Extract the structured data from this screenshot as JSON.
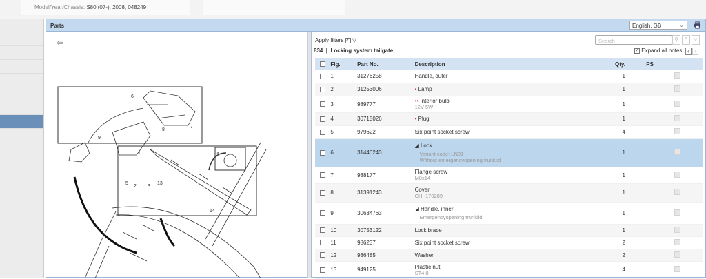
{
  "header": {
    "model_label": "Model/Year/Chassis:",
    "model_value": "S80 (07-), 2008, 048249"
  },
  "panel": {
    "title": "Parts",
    "language": "English, GB"
  },
  "toolbar": {
    "apply_filters": "Apply filters",
    "search_placeholder": "Search",
    "expand_all_notes": "Expand all notes",
    "group_title": "834  |  Locking system tailgate"
  },
  "columns": [
    "Fig.",
    "Part No.",
    "Description",
    "Qty.",
    "PS"
  ],
  "rows": [
    {
      "fig": "1",
      "part": "31276258",
      "marker": "",
      "desc": "Handle, outer",
      "sub": "",
      "qty": "1"
    },
    {
      "fig": "2",
      "part": "31253006",
      "marker": "•",
      "desc": "Lamp",
      "sub": "",
      "qty": "1"
    },
    {
      "fig": "3",
      "part": "989777",
      "marker": "••",
      "desc": "Interior bulb",
      "sub": "12V 5W",
      "qty": "1"
    },
    {
      "fig": "4",
      "part": "30715026",
      "marker": "•",
      "desc": "Plug",
      "sub": "",
      "qty": "1"
    },
    {
      "fig": "5",
      "part": "979622",
      "marker": "",
      "desc": "Six point socket screw",
      "sub": "",
      "qty": "4"
    },
    {
      "fig": "6",
      "part": "31440243",
      "marker": "◢",
      "desc": "Lock",
      "sub": "Variant code: LN01",
      "sub2": "Without emergencyopening trunklid",
      "qty": "1"
    },
    {
      "fig": "7",
      "part": "988177",
      "marker": "",
      "desc": "Flange screw",
      "sub": "M8x14",
      "qty": "1"
    },
    {
      "fig": "8",
      "part": "31391243",
      "marker": "",
      "desc": "Cover",
      "sub": "CH -170289",
      "qty": "1"
    },
    {
      "fig": "9",
      "part": "30634763",
      "marker": "◢",
      "desc": "Handle, inner",
      "sub": "Emergencyopening trunklid.",
      "qty": "1"
    },
    {
      "fig": "10",
      "part": "30753122",
      "marker": "",
      "desc": "Lock brace",
      "sub": "",
      "qty": "1"
    },
    {
      "fig": "11",
      "part": "986237",
      "marker": "",
      "desc": "Six point socket screw",
      "sub": "",
      "qty": "2"
    },
    {
      "fig": "12",
      "part": "986485",
      "marker": "",
      "desc": "Washer",
      "sub": "",
      "qty": "2"
    },
    {
      "fig": "13",
      "part": "949125",
      "marker": "",
      "desc": "Plastic nut",
      "sub": "ST4.8",
      "qty": "4"
    }
  ],
  "diagram_callouts": [
    "1",
    "2",
    "3",
    "4",
    "5",
    "6",
    "7",
    "8",
    "9",
    "13",
    "14"
  ]
}
